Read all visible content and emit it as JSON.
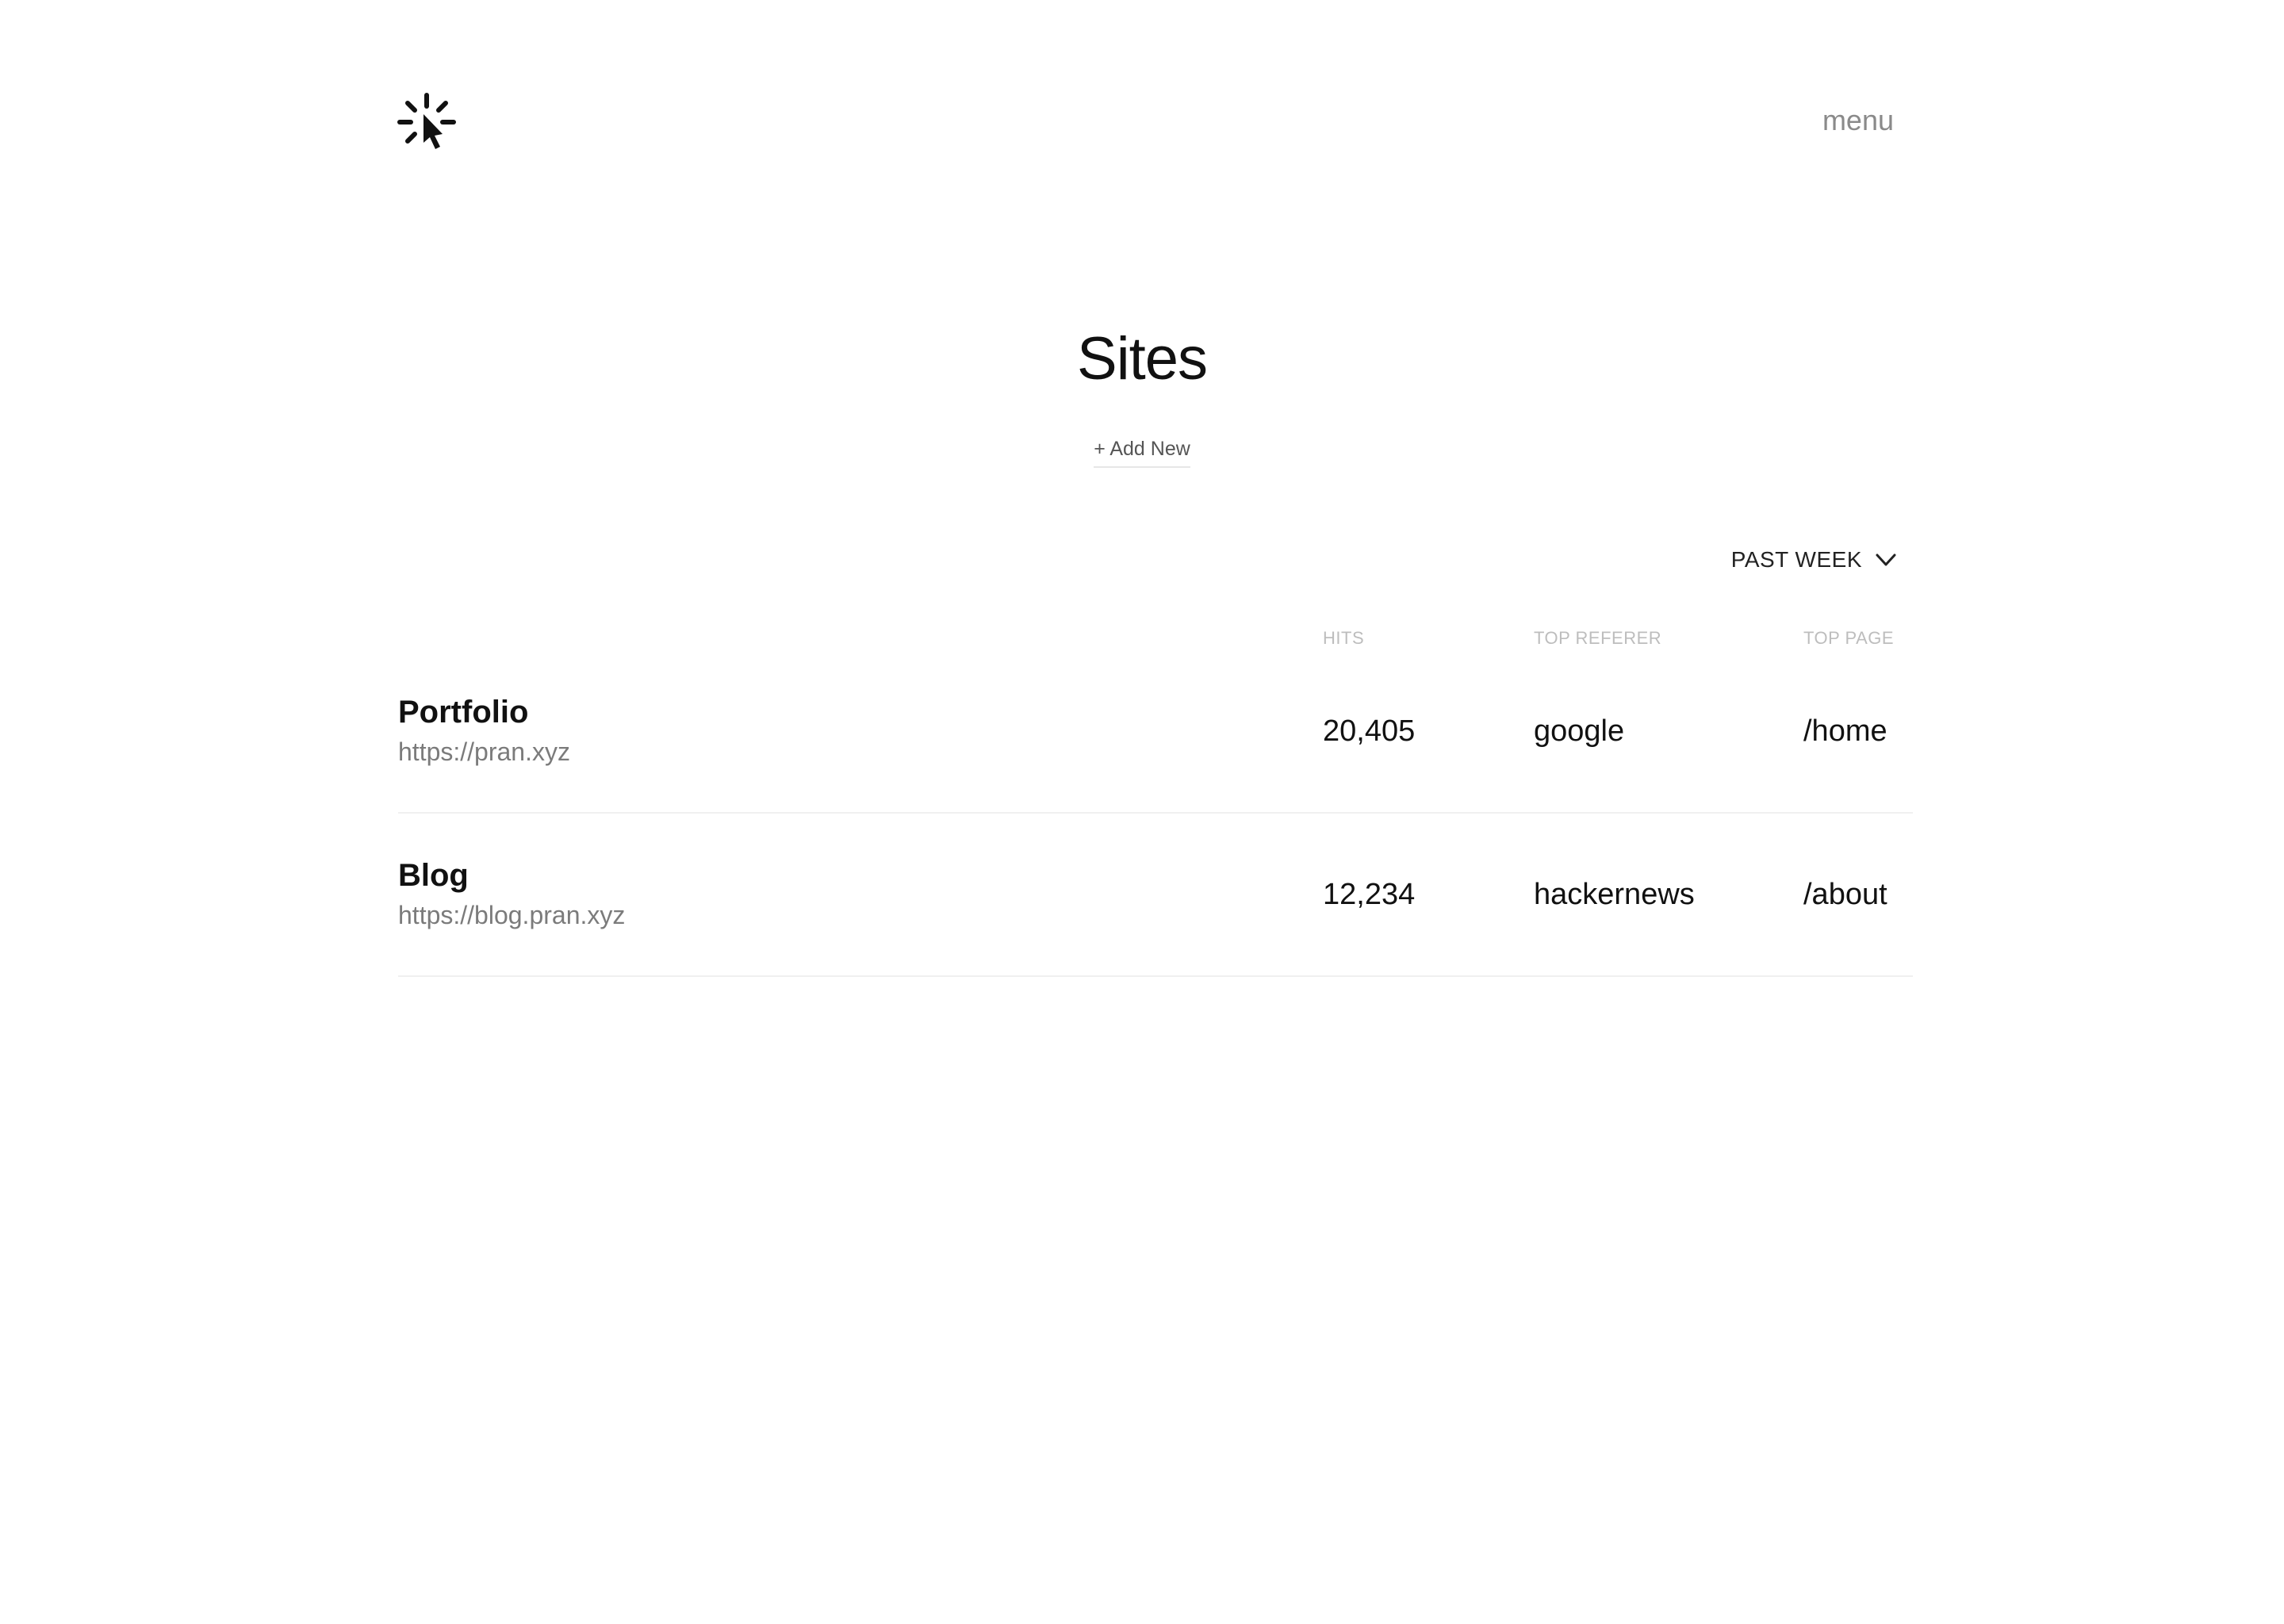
{
  "header": {
    "logo_icon": "click-cursor-icon",
    "menu_label": "menu"
  },
  "main": {
    "title": "Sites",
    "add_new_label": "+ Add New",
    "period_label": "PAST WEEK",
    "period_icon": "chevron-down-icon"
  },
  "table": {
    "columns": [
      "HITS",
      "TOP REFERER",
      "TOP PAGE"
    ],
    "rows": [
      {
        "name": "Portfolio",
        "url": "https://pran.xyz",
        "hits": "20,405",
        "top_referer": "google",
        "top_page": "/home"
      },
      {
        "name": "Blog",
        "url": "https://blog.pran.xyz",
        "hits": "12,234",
        "top_referer": "hackernews",
        "top_page": "/about"
      }
    ]
  },
  "colors": {
    "text_primary": "#111111",
    "text_muted": "#7b7b7b",
    "column_header": "#bdbdbd",
    "divider": "#f0f0f0"
  }
}
